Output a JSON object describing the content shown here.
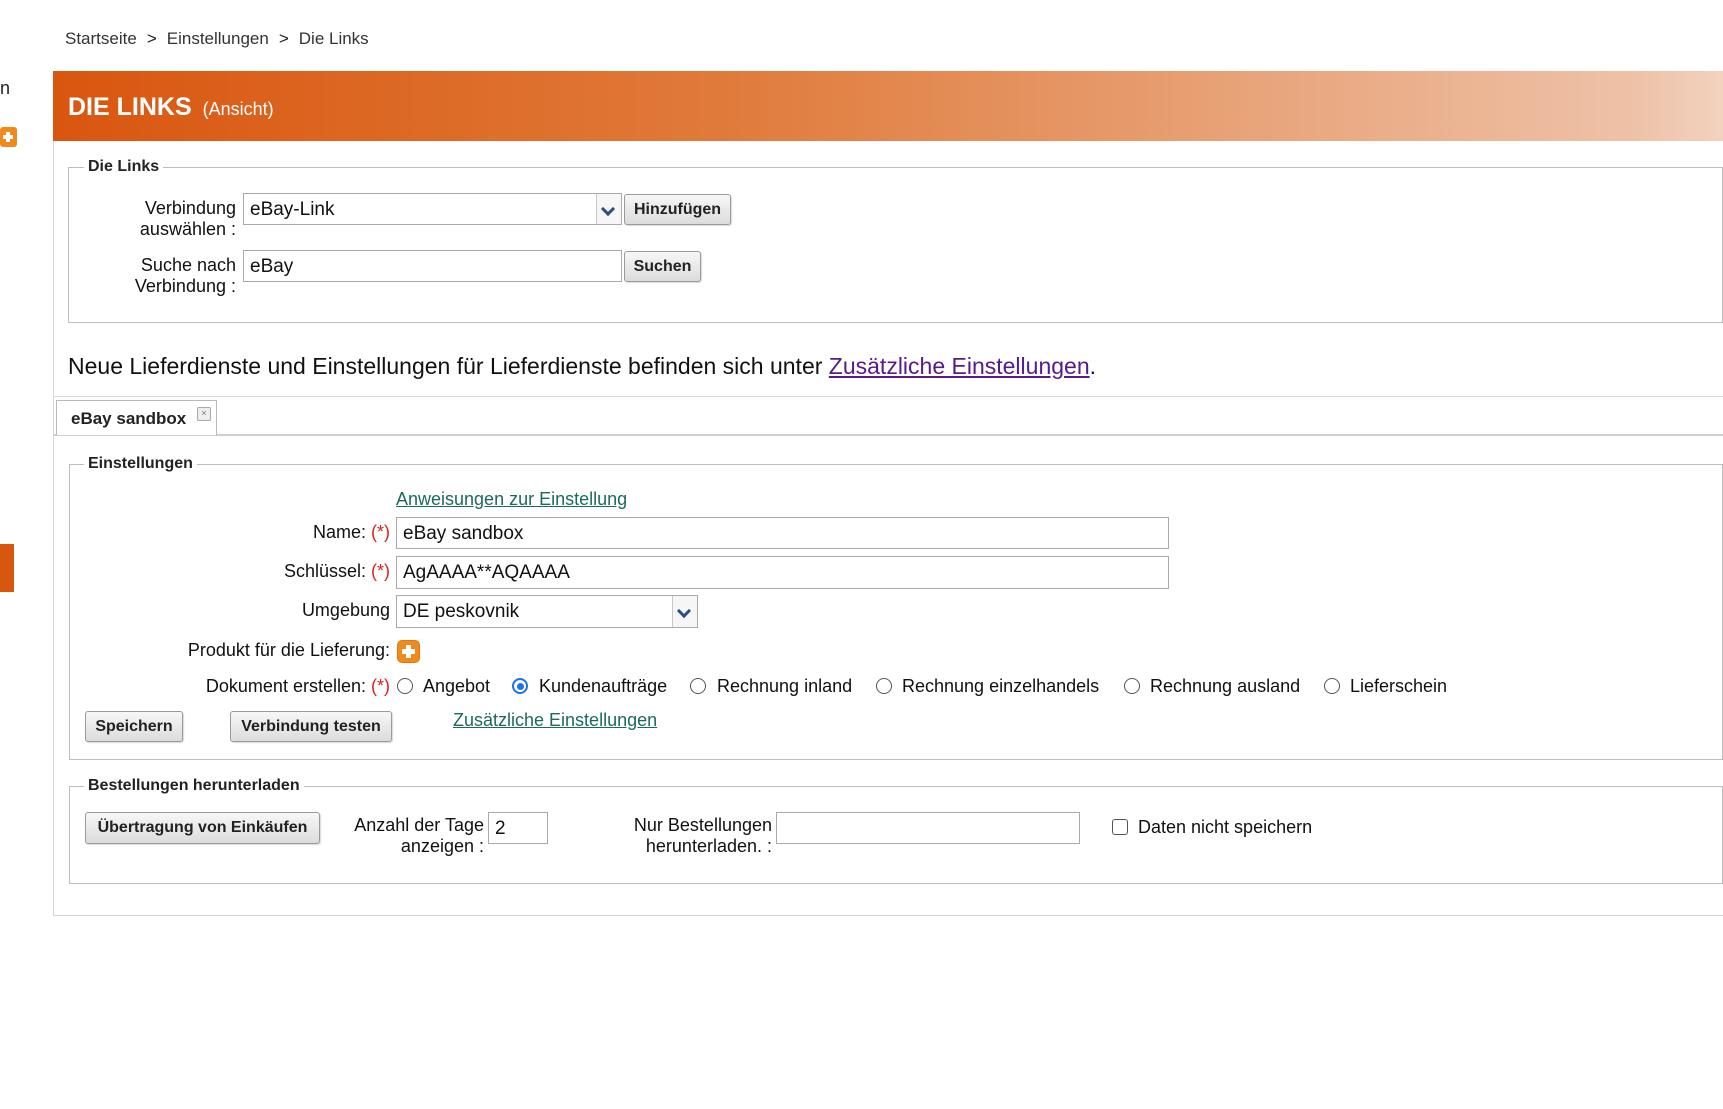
{
  "breadcrumb": {
    "items": [
      "Startseite",
      "Einstellungen",
      "Die Links"
    ],
    "separator": ">"
  },
  "header": {
    "title": "DIE LINKS",
    "subtitle": "(Ansicht)"
  },
  "left_remnant": {
    "char": "n"
  },
  "links_section": {
    "legend": "Die Links",
    "connection_label_1": "Verbindung",
    "connection_label_2": "auswählen :",
    "connection_value": "eBay-Link",
    "add_button": "Hinzufügen",
    "search_label_1": "Suche nach",
    "search_label_2": "Verbindung :",
    "search_value": "eBay",
    "search_button": "Suchen"
  },
  "notice": {
    "text": "Neue Lieferdienste und Einstellungen für Lieferdienste befinden sich unter ",
    "link": "Zusätzliche Einstellungen",
    "suffix": "."
  },
  "tab": {
    "label": "eBay sandbox",
    "close_glyph": "×"
  },
  "settings": {
    "legend": "Einstellungen",
    "instructions_link": "Anweisungen zur Einstellung",
    "name_label": "Name:",
    "required_marker": "(*)",
    "name_value": "eBay sandbox",
    "key_label": "Schlüssel:",
    "key_value": "AgAAAA**AQAAAA",
    "env_label": "Umgebung",
    "env_value": "DE peskovnik",
    "product_label": "Produkt für die Lieferung:",
    "document_label": "Dokument erstellen:",
    "document_options": [
      "Angebot",
      "Kundenaufträge",
      "Rechnung inland",
      "Rechnung einzelhandels",
      "Rechnung ausland",
      "Lieferschein"
    ],
    "document_selected": "Kundenaufträge",
    "save_button": "Speichern",
    "test_button": "Verbindung testen",
    "extra_link": "Zusätzliche Einstellungen"
  },
  "orders": {
    "legend": "Bestellungen herunterladen",
    "transfer_button": "Übertragung von Einkäufen",
    "days_label_1": "Anzahl der Tage",
    "days_label_2": "anzeigen :",
    "days_value": "2",
    "only_label_1": "Nur Bestellungen",
    "only_label_2": "herunterladen. :",
    "only_value": "",
    "nosave_label": "Daten nicht speichern",
    "nosave_checked": false
  },
  "colors": {
    "accent": "#d9560f",
    "link": "#1a6b5b",
    "link_visited": "#551a8b",
    "required": "#e02020",
    "radio_selected": "#1a73e8"
  }
}
